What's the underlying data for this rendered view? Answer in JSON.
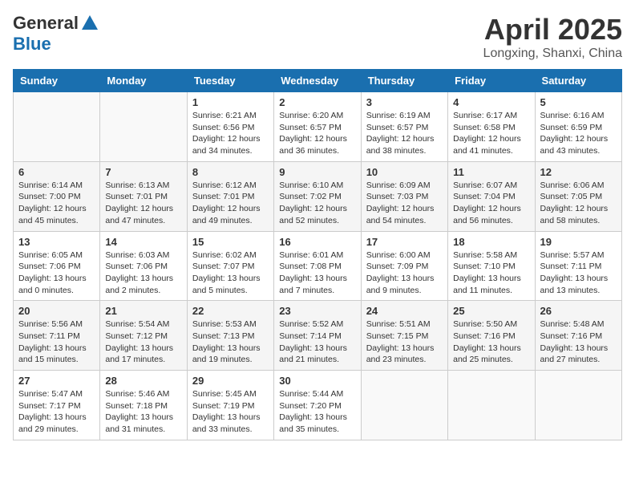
{
  "header": {
    "logo_general": "General",
    "logo_blue": "Blue",
    "title": "April 2025",
    "subtitle": "Longxing, Shanxi, China"
  },
  "weekdays": [
    "Sunday",
    "Monday",
    "Tuesday",
    "Wednesday",
    "Thursday",
    "Friday",
    "Saturday"
  ],
  "weeks": [
    [
      {
        "day": "",
        "sunrise": "",
        "sunset": "",
        "daylight": ""
      },
      {
        "day": "",
        "sunrise": "",
        "sunset": "",
        "daylight": ""
      },
      {
        "day": "1",
        "sunrise": "Sunrise: 6:21 AM",
        "sunset": "Sunset: 6:56 PM",
        "daylight": "Daylight: 12 hours and 34 minutes."
      },
      {
        "day": "2",
        "sunrise": "Sunrise: 6:20 AM",
        "sunset": "Sunset: 6:57 PM",
        "daylight": "Daylight: 12 hours and 36 minutes."
      },
      {
        "day": "3",
        "sunrise": "Sunrise: 6:19 AM",
        "sunset": "Sunset: 6:57 PM",
        "daylight": "Daylight: 12 hours and 38 minutes."
      },
      {
        "day": "4",
        "sunrise": "Sunrise: 6:17 AM",
        "sunset": "Sunset: 6:58 PM",
        "daylight": "Daylight: 12 hours and 41 minutes."
      },
      {
        "day": "5",
        "sunrise": "Sunrise: 6:16 AM",
        "sunset": "Sunset: 6:59 PM",
        "daylight": "Daylight: 12 hours and 43 minutes."
      }
    ],
    [
      {
        "day": "6",
        "sunrise": "Sunrise: 6:14 AM",
        "sunset": "Sunset: 7:00 PM",
        "daylight": "Daylight: 12 hours and 45 minutes."
      },
      {
        "day": "7",
        "sunrise": "Sunrise: 6:13 AM",
        "sunset": "Sunset: 7:01 PM",
        "daylight": "Daylight: 12 hours and 47 minutes."
      },
      {
        "day": "8",
        "sunrise": "Sunrise: 6:12 AM",
        "sunset": "Sunset: 7:01 PM",
        "daylight": "Daylight: 12 hours and 49 minutes."
      },
      {
        "day": "9",
        "sunrise": "Sunrise: 6:10 AM",
        "sunset": "Sunset: 7:02 PM",
        "daylight": "Daylight: 12 hours and 52 minutes."
      },
      {
        "day": "10",
        "sunrise": "Sunrise: 6:09 AM",
        "sunset": "Sunset: 7:03 PM",
        "daylight": "Daylight: 12 hours and 54 minutes."
      },
      {
        "day": "11",
        "sunrise": "Sunrise: 6:07 AM",
        "sunset": "Sunset: 7:04 PM",
        "daylight": "Daylight: 12 hours and 56 minutes."
      },
      {
        "day": "12",
        "sunrise": "Sunrise: 6:06 AM",
        "sunset": "Sunset: 7:05 PM",
        "daylight": "Daylight: 12 hours and 58 minutes."
      }
    ],
    [
      {
        "day": "13",
        "sunrise": "Sunrise: 6:05 AM",
        "sunset": "Sunset: 7:06 PM",
        "daylight": "Daylight: 13 hours and 0 minutes."
      },
      {
        "day": "14",
        "sunrise": "Sunrise: 6:03 AM",
        "sunset": "Sunset: 7:06 PM",
        "daylight": "Daylight: 13 hours and 2 minutes."
      },
      {
        "day": "15",
        "sunrise": "Sunrise: 6:02 AM",
        "sunset": "Sunset: 7:07 PM",
        "daylight": "Daylight: 13 hours and 5 minutes."
      },
      {
        "day": "16",
        "sunrise": "Sunrise: 6:01 AM",
        "sunset": "Sunset: 7:08 PM",
        "daylight": "Daylight: 13 hours and 7 minutes."
      },
      {
        "day": "17",
        "sunrise": "Sunrise: 6:00 AM",
        "sunset": "Sunset: 7:09 PM",
        "daylight": "Daylight: 13 hours and 9 minutes."
      },
      {
        "day": "18",
        "sunrise": "Sunrise: 5:58 AM",
        "sunset": "Sunset: 7:10 PM",
        "daylight": "Daylight: 13 hours and 11 minutes."
      },
      {
        "day": "19",
        "sunrise": "Sunrise: 5:57 AM",
        "sunset": "Sunset: 7:11 PM",
        "daylight": "Daylight: 13 hours and 13 minutes."
      }
    ],
    [
      {
        "day": "20",
        "sunrise": "Sunrise: 5:56 AM",
        "sunset": "Sunset: 7:11 PM",
        "daylight": "Daylight: 13 hours and 15 minutes."
      },
      {
        "day": "21",
        "sunrise": "Sunrise: 5:54 AM",
        "sunset": "Sunset: 7:12 PM",
        "daylight": "Daylight: 13 hours and 17 minutes."
      },
      {
        "day": "22",
        "sunrise": "Sunrise: 5:53 AM",
        "sunset": "Sunset: 7:13 PM",
        "daylight": "Daylight: 13 hours and 19 minutes."
      },
      {
        "day": "23",
        "sunrise": "Sunrise: 5:52 AM",
        "sunset": "Sunset: 7:14 PM",
        "daylight": "Daylight: 13 hours and 21 minutes."
      },
      {
        "day": "24",
        "sunrise": "Sunrise: 5:51 AM",
        "sunset": "Sunset: 7:15 PM",
        "daylight": "Daylight: 13 hours and 23 minutes."
      },
      {
        "day": "25",
        "sunrise": "Sunrise: 5:50 AM",
        "sunset": "Sunset: 7:16 PM",
        "daylight": "Daylight: 13 hours and 25 minutes."
      },
      {
        "day": "26",
        "sunrise": "Sunrise: 5:48 AM",
        "sunset": "Sunset: 7:16 PM",
        "daylight": "Daylight: 13 hours and 27 minutes."
      }
    ],
    [
      {
        "day": "27",
        "sunrise": "Sunrise: 5:47 AM",
        "sunset": "Sunset: 7:17 PM",
        "daylight": "Daylight: 13 hours and 29 minutes."
      },
      {
        "day": "28",
        "sunrise": "Sunrise: 5:46 AM",
        "sunset": "Sunset: 7:18 PM",
        "daylight": "Daylight: 13 hours and 31 minutes."
      },
      {
        "day": "29",
        "sunrise": "Sunrise: 5:45 AM",
        "sunset": "Sunset: 7:19 PM",
        "daylight": "Daylight: 13 hours and 33 minutes."
      },
      {
        "day": "30",
        "sunrise": "Sunrise: 5:44 AM",
        "sunset": "Sunset: 7:20 PM",
        "daylight": "Daylight: 13 hours and 35 minutes."
      },
      {
        "day": "",
        "sunrise": "",
        "sunset": "",
        "daylight": ""
      },
      {
        "day": "",
        "sunrise": "",
        "sunset": "",
        "daylight": ""
      },
      {
        "day": "",
        "sunrise": "",
        "sunset": "",
        "daylight": ""
      }
    ]
  ]
}
